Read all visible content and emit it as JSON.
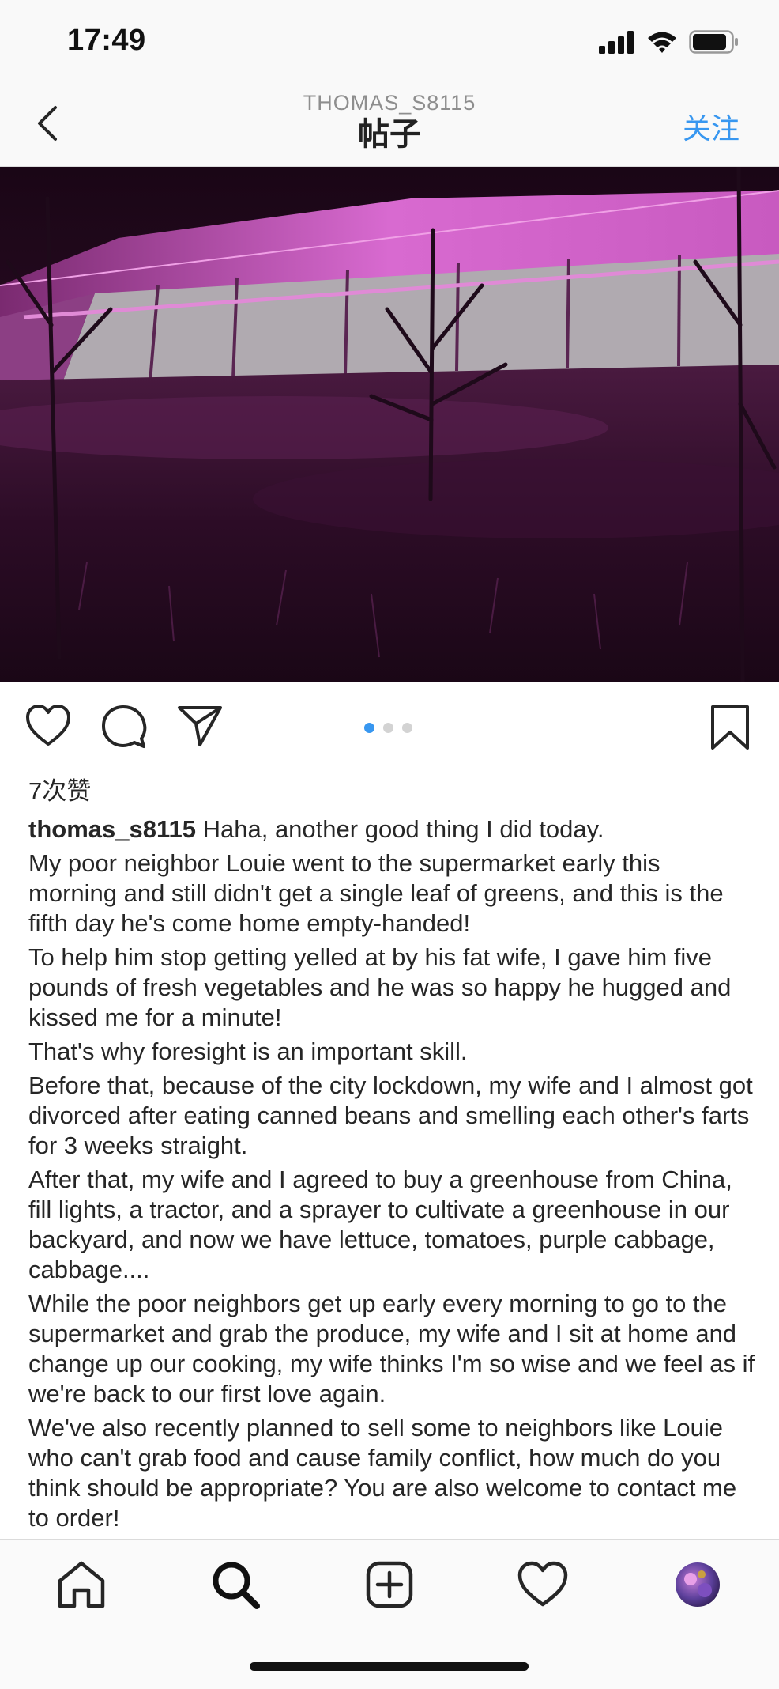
{
  "status_bar": {
    "time": "17:49"
  },
  "nav": {
    "username": "THOMAS_S8115",
    "title": "帖子",
    "follow_label": "关注"
  },
  "post": {
    "likes_text": "7次赞",
    "author": "thomas_s8115",
    "caption_lines": [
      "Haha, another good thing I did today.",
      "My poor neighbor Louie went to the supermarket early this morning and still didn't get a single leaf of greens, and this is the fifth day he's come home empty-handed!",
      "To help him stop getting yelled at by his fat wife, I gave him five pounds of fresh vegetables and he was so happy he hugged and kissed me for a minute!",
      "That's why foresight is an important skill.",
      "Before that, because of the city lockdown, my wife and I almost got divorced after eating canned beans and smelling each other's farts for 3 weeks straight.",
      "After that, my wife and I agreed to buy a greenhouse from China, fill lights, a tractor, and a sprayer to cultivate a greenhouse in our backyard, and now we have lettuce, tomatoes, purple cabbage, cabbage....",
      "While the poor neighbors get up early every morning to go to the supermarket and grab the produce, my wife and I sit at home and change up our cooking, my wife thinks I'm so wise and we feel as if we're back to our first love again.",
      "We've also recently planned to sell some to neighbors like Louie who can't grab food and cause family conflict, how much do you think should be appropriate? You are also welcome to contact me to order!"
    ],
    "carousel": {
      "count": 3,
      "active_index": 0
    }
  },
  "icons": {
    "back": "chevron-left-icon",
    "like": "heart-icon",
    "comment": "comment-icon",
    "share": "send-icon",
    "save": "bookmark-icon",
    "tabs": [
      "home-icon",
      "search-icon",
      "add-post-icon",
      "activity-heart-icon",
      "profile-avatar"
    ]
  },
  "colors": {
    "accent": "#3897f0",
    "text": "#262626",
    "muted": "#8e8e8e",
    "photo_tint": "#b040b0"
  }
}
